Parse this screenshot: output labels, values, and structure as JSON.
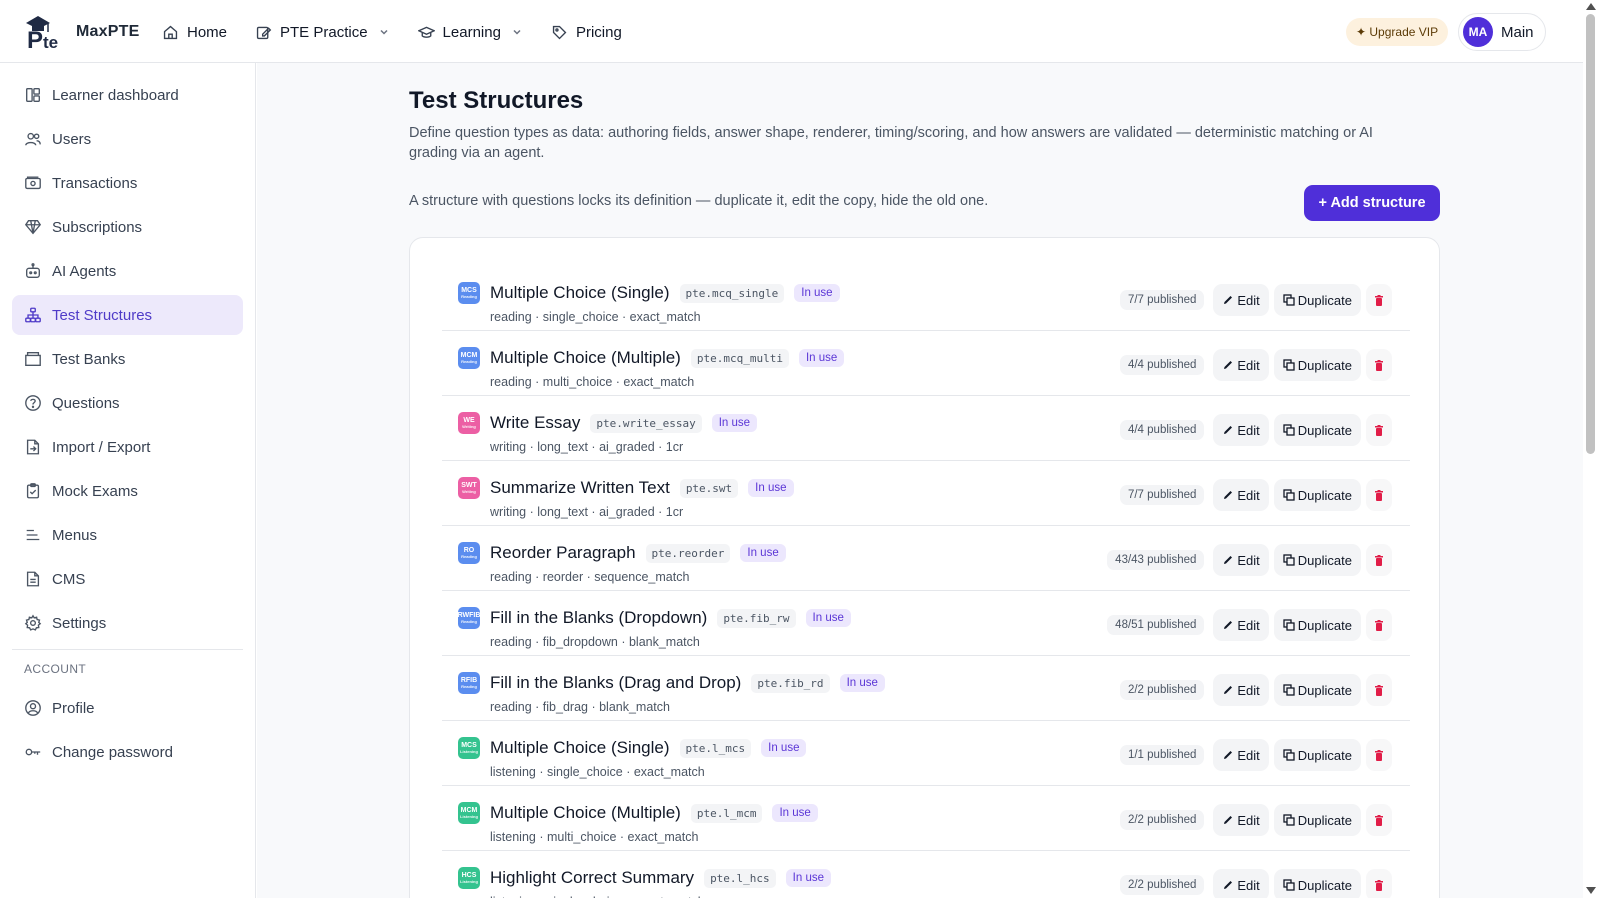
{
  "brand": {
    "name": "MaxPTE"
  },
  "nav": [
    {
      "label": "Home",
      "icon": "home-icon"
    },
    {
      "label": "PTE Practice",
      "icon": "edit-icon",
      "dropdown": true
    },
    {
      "label": "Learning",
      "icon": "graduation-cap-icon",
      "dropdown": true
    },
    {
      "label": "Pricing",
      "icon": "tag-icon"
    }
  ],
  "header": {
    "upgrade_label": "✦ Upgrade VIP",
    "avatar_initials": "MA",
    "user_name": "Main"
  },
  "sidebar": {
    "items": [
      {
        "label": "Learner dashboard",
        "icon": "dashboard-icon"
      },
      {
        "label": "Users",
        "icon": "users-icon"
      },
      {
        "label": "Transactions",
        "icon": "money-icon"
      },
      {
        "label": "Subscriptions",
        "icon": "diamond-icon"
      },
      {
        "label": "AI Agents",
        "icon": "robot-icon"
      },
      {
        "label": "Test Structures",
        "icon": "hierarchy-icon",
        "active": true
      },
      {
        "label": "Test Banks",
        "icon": "folder-icon"
      },
      {
        "label": "Questions",
        "icon": "question-icon"
      },
      {
        "label": "Import / Export",
        "icon": "import-icon"
      },
      {
        "label": "Mock Exams",
        "icon": "clipboard-icon"
      },
      {
        "label": "Menus",
        "icon": "menu-icon"
      },
      {
        "label": "CMS",
        "icon": "document-icon"
      },
      {
        "label": "Settings",
        "icon": "gear-icon"
      }
    ],
    "account_heading": "ACCOUNT",
    "account_items": [
      {
        "label": "Profile",
        "icon": "profile-icon"
      },
      {
        "label": "Change password",
        "icon": "key-icon"
      }
    ]
  },
  "main": {
    "title": "Test Structures",
    "description": "Define question types as data: authoring fields, answer shape, renderer, timing/scoring, and how answers are validated — deterministic matching or AI grading via an agent.",
    "lock_note": "A structure with questions locks its definition — duplicate it, edit the copy, hide the old one.",
    "add_label": "+ Add structure",
    "actions": {
      "edit": "Edit",
      "duplicate": "Duplicate"
    },
    "rows": [
      {
        "icon_text": "MCS",
        "icon_sub": "Reading",
        "icon_color": "#5b8def",
        "name": "Multiple Choice (Single)",
        "code": "pte.mcq_single",
        "badge": "In use",
        "meta": "reading · single_choice · exact_match",
        "published": "7/7 published"
      },
      {
        "icon_text": "MCM",
        "icon_sub": "Reading",
        "icon_color": "#5b8def",
        "name": "Multiple Choice (Multiple)",
        "code": "pte.mcq_multi",
        "badge": "In use",
        "meta": "reading · multi_choice · exact_match",
        "published": "4/4 published"
      },
      {
        "icon_text": "WE",
        "icon_sub": "Writing",
        "icon_color": "#ec5fa4",
        "name": "Write Essay",
        "code": "pte.write_essay",
        "badge": "In use",
        "meta": "writing · long_text · ai_graded · 1cr",
        "published": "4/4 published"
      },
      {
        "icon_text": "SWT",
        "icon_sub": "Writing",
        "icon_color": "#ec5fa4",
        "name": "Summarize Written Text",
        "code": "pte.swt",
        "badge": "In use",
        "meta": "writing · long_text · ai_graded · 1cr",
        "published": "7/7 published"
      },
      {
        "icon_text": "RO",
        "icon_sub": "Reading",
        "icon_color": "#5b8def",
        "name": "Reorder Paragraph",
        "code": "pte.reorder",
        "badge": "In use",
        "meta": "reading · reorder · sequence_match",
        "published": "43/43 published"
      },
      {
        "icon_text": "RWFIB",
        "icon_sub": "Reading",
        "icon_color": "#5b8def",
        "name": "Fill in the Blanks (Dropdown)",
        "code": "pte.fib_rw",
        "badge": "In use",
        "meta": "reading · fib_dropdown · blank_match",
        "published": "48/51 published"
      },
      {
        "icon_text": "RFIB",
        "icon_sub": "Reading",
        "icon_color": "#5b8def",
        "name": "Fill in the Blanks (Drag and Drop)",
        "code": "pte.fib_rd",
        "badge": "In use",
        "meta": "reading · fib_drag · blank_match",
        "published": "2/2 published"
      },
      {
        "icon_text": "MCS",
        "icon_sub": "Listening",
        "icon_color": "#34c38f",
        "name": "Multiple Choice (Single)",
        "code": "pte.l_mcs",
        "badge": "In use",
        "meta": "listening · single_choice · exact_match",
        "published": "1/1 published"
      },
      {
        "icon_text": "MCM",
        "icon_sub": "Listening",
        "icon_color": "#34c38f",
        "name": "Multiple Choice (Multiple)",
        "code": "pte.l_mcm",
        "badge": "In use",
        "meta": "listening · multi_choice · exact_match",
        "published": "2/2 published"
      },
      {
        "icon_text": "HCS",
        "icon_sub": "Listening",
        "icon_color": "#34c38f",
        "name": "Highlight Correct Summary",
        "code": "pte.l_hcs",
        "badge": "In use",
        "meta": "listening · single_choice · exact_match",
        "published": "2/2 published"
      }
    ]
  }
}
